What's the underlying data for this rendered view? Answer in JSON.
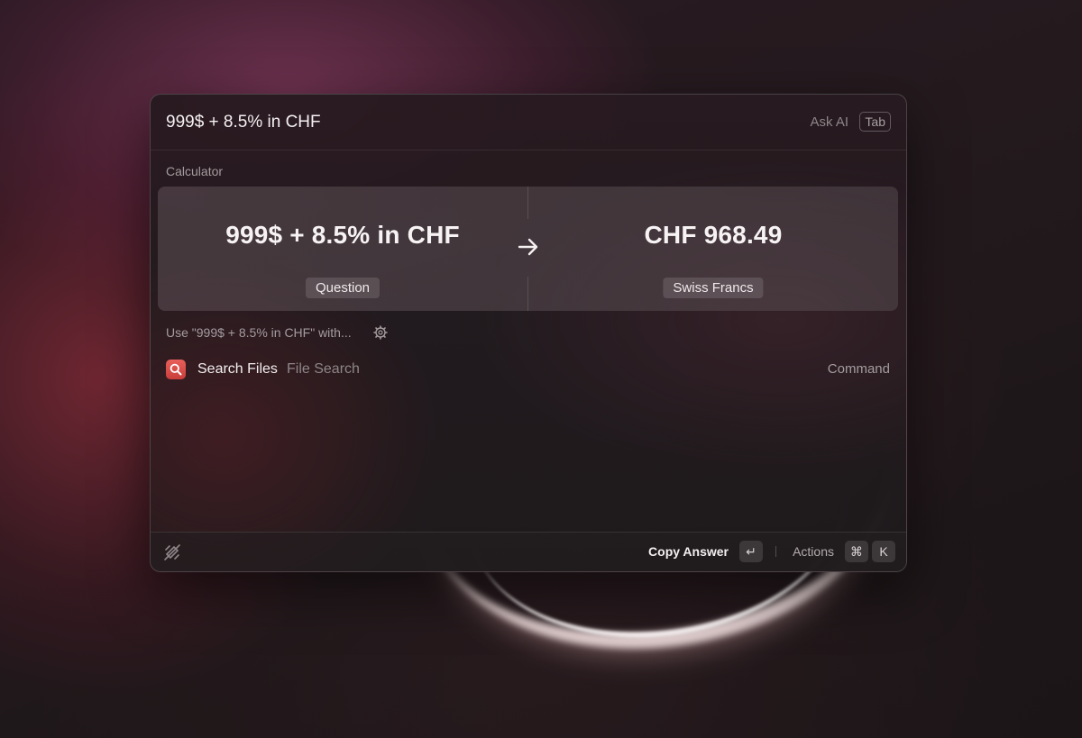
{
  "search": {
    "query": "999$ + 8.5% in CHF",
    "ask_ai_label": "Ask AI",
    "ask_ai_key": "Tab"
  },
  "calculator": {
    "section_label": "Calculator",
    "question": "999$ + 8.5% in CHF",
    "question_tag": "Question",
    "answer": "CHF 968.49",
    "answer_tag": "Swiss Francs",
    "arrow_icon": "arrow-right-icon"
  },
  "use_with": {
    "label": "Use \"999$ + 8.5% in CHF\" with...",
    "icon": "gear-icon"
  },
  "results": [
    {
      "title": "Search Files",
      "subtitle": "File Search",
      "type": "Command",
      "icon": "magnifier-icon",
      "icon_color": "#e0544f"
    }
  ],
  "footer": {
    "logo_icon": "raycast-logo-icon",
    "primary_action": "Copy Answer",
    "primary_key": "↵",
    "actions_label": "Actions",
    "actions_keys": [
      "⌘",
      "K"
    ]
  }
}
